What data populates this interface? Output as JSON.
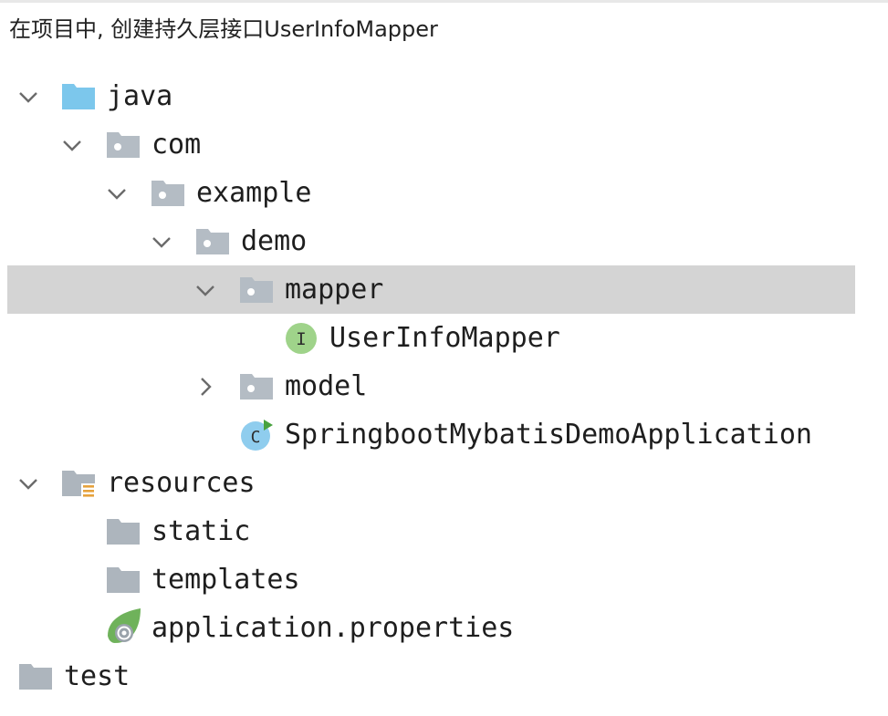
{
  "heading": "在项目中, 创建持久层接口UserInfoMapper",
  "tree": {
    "java": "java",
    "com": "com",
    "example": "example",
    "demo": "demo",
    "mapper": "mapper",
    "user_info_mapper": "UserInfoMapper",
    "user_info_mapper_badge": "I",
    "model": "model",
    "app_class": "SpringbootMybatisDemoApplication",
    "app_class_badge": "C",
    "resources": "resources",
    "static": "static",
    "templates": "templates",
    "application_properties": "application.properties",
    "test": "test"
  },
  "colors": {
    "source_folder": "#7cc7ec",
    "package_folder": "#b4bcc4",
    "plain_folder": "#adb5bd",
    "selection": "#d4d4d4",
    "interface_badge": "#9fd38a",
    "class_badge": "#8fcdee",
    "run_marker": "#48a23f",
    "resources_marker": "#e6a23c",
    "spring_leaf": "#6fb25b"
  }
}
